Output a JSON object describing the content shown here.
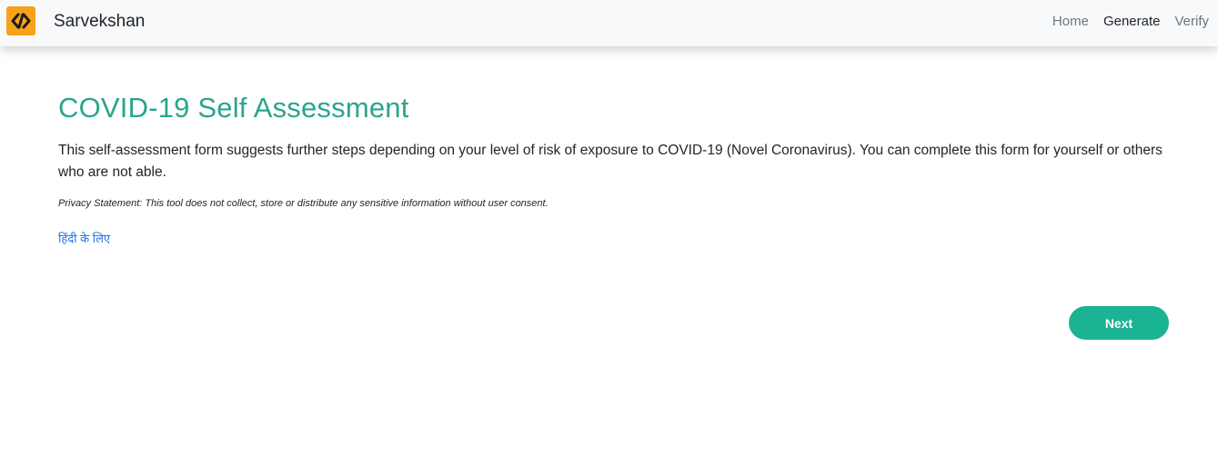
{
  "navbar": {
    "brand": "Sarvekshan",
    "logo_icon": "code-brackets-icon",
    "links": [
      {
        "label": "Home",
        "active": false
      },
      {
        "label": "Generate",
        "active": true
      },
      {
        "label": "Verify",
        "active": false
      }
    ]
  },
  "main": {
    "title": "COVID-19 Self Assessment",
    "intro": "This self-assessment form suggests further steps depending on your level of risk of exposure to COVID-19 (Novel Coronavirus). You can complete this form for yourself or others who are not able.",
    "privacy": "Privacy Statement: This tool does not collect, store or distribute any sensitive information without user consent.",
    "hindi_link": "हिंदी के लिए",
    "next_label": "Next"
  },
  "colors": {
    "accent": "#2aa58c",
    "button": "#1ab394",
    "logo": "#f7a21b",
    "link": "#1a73e8"
  }
}
